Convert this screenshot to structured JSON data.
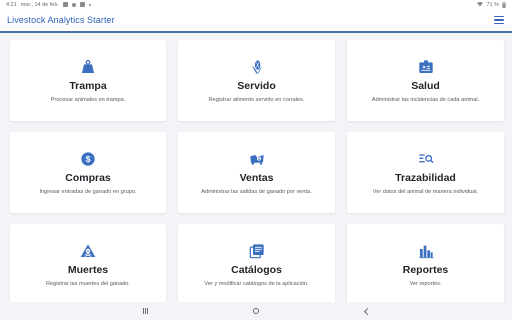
{
  "status_bar": {
    "time": "4:21",
    "date": "mar., 14 de feb.",
    "battery": "71 %"
  },
  "app_bar": {
    "title": "Livestock Analytics Starter",
    "menu_icon": "hamburger-menu-icon"
  },
  "colors": {
    "accent": "#3b6fc0",
    "title_color": "#2e62b8",
    "background": "#f2f4f7",
    "card": "#ffffff"
  },
  "cards": [
    {
      "icon": "weight-icon",
      "title": "Trampa",
      "description": "Procesar animales en trampa."
    },
    {
      "icon": "corn-icon",
      "title": "Servido",
      "description": "Registrar alimento servido en corrales."
    },
    {
      "icon": "medical-id-icon",
      "title": "Salud",
      "description": "Administrar las incidencias de cada animal."
    },
    {
      "icon": "dollar-coin-icon",
      "title": "Compras",
      "description": "Ingresar entradas de ganado en grupo."
    },
    {
      "icon": "truck-dollar-icon",
      "title": "Ventas",
      "description": "Administrar las salidas de ganado por venta."
    },
    {
      "icon": "list-search-icon",
      "title": "Trazabilidad",
      "description": "Ver datos del animal de manera individual."
    },
    {
      "icon": "skull-warning-icon",
      "title": "Muertes",
      "description": "Registrar las muertes del ganado."
    },
    {
      "icon": "catalog-icon",
      "title": "Catálogos",
      "description": "Ver y modificar catálogos de la aplicación."
    },
    {
      "icon": "bar-chart-icon",
      "title": "Reportes",
      "description": "Ver reportes."
    }
  ],
  "nav_bar": {
    "recents_icon": "recents-icon",
    "home_icon": "home-icon",
    "back_icon": "back-icon"
  }
}
